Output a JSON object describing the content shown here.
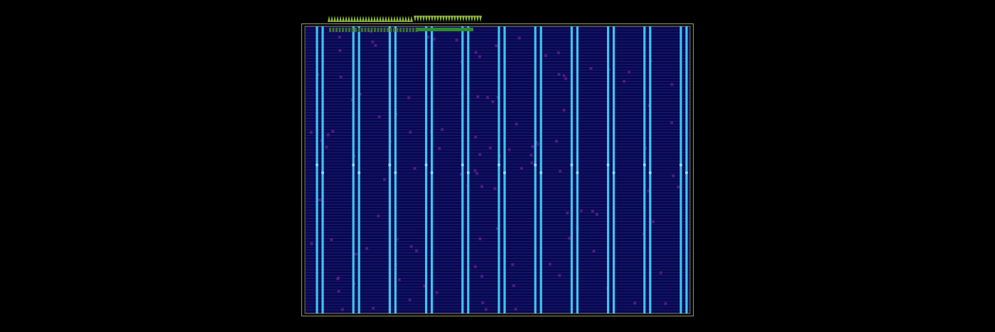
{
  "layout_view": {
    "colors": {
      "background": "#000000",
      "die_outline": "#9a9a6a",
      "core_fill": "#080850",
      "row_lines": "#3a3ab0",
      "power_straps": "#3ec4ee",
      "cells": "#5a1a8a",
      "io_pins": "#8fb840",
      "pin_bar": "#2e8b2e"
    },
    "power_strap_pairs": 11,
    "standard_cell_rows": 100,
    "io_pin_groups": [
      {
        "name": "pins-up",
        "count": 30
      },
      {
        "name": "pins-down",
        "count": 24
      }
    ]
  }
}
